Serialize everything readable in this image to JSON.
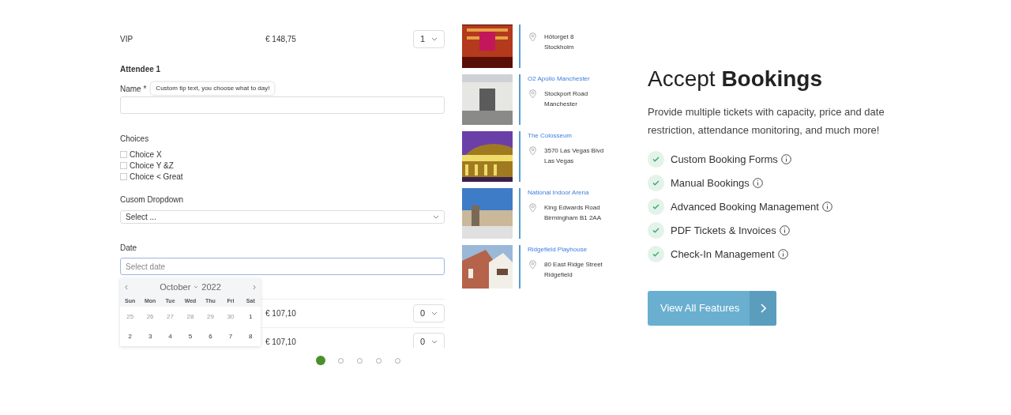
{
  "tickets": [
    {
      "name": "VIP",
      "price": "€ 148,75",
      "quantity": "1"
    }
  ],
  "attendee": {
    "title": "Attendee 1",
    "name_label": "Name *",
    "tooltip": "Custom tip text, you choose what to day!",
    "choices_label": "Choices",
    "choices": [
      {
        "label": "Choice X",
        "checked": false
      },
      {
        "label": "Choice Y &Z",
        "checked": false
      },
      {
        "label": "Choice < Great",
        "checked": false
      }
    ],
    "dropdown_label": "Cusom Dropdown",
    "dropdown_value": "Select ...",
    "date_label": "Date",
    "date_placeholder": "Select date"
  },
  "calendar": {
    "month": "October",
    "year": "2022",
    "prev": "‹",
    "next": "›",
    "weekdays": [
      "Sun",
      "Mon",
      "Tue",
      "Wed",
      "Thu",
      "Fri",
      "Sat"
    ],
    "weeks": [
      [
        {
          "day": "25",
          "muted": true
        },
        {
          "day": "26",
          "muted": true
        },
        {
          "day": "27",
          "muted": true
        },
        {
          "day": "28",
          "muted": true
        },
        {
          "day": "29",
          "muted": true
        },
        {
          "day": "30",
          "muted": true
        },
        {
          "day": "1",
          "muted": false
        }
      ],
      [
        {
          "day": "2",
          "muted": false
        },
        {
          "day": "3",
          "muted": false
        },
        {
          "day": "4",
          "muted": false
        },
        {
          "day": "5",
          "muted": false
        },
        {
          "day": "6",
          "muted": false
        },
        {
          "day": "7",
          "muted": false
        },
        {
          "day": "8",
          "muted": false
        }
      ]
    ]
  },
  "more_tickets": [
    {
      "price": "€ 107,10",
      "quantity": "0"
    },
    {
      "price": "€ 107,10",
      "quantity": "0"
    }
  ],
  "venues": [
    {
      "address": "Hötorget 8",
      "city": "Stockholm"
    },
    {
      "name": "O2 Apollo Manchester",
      "address": "Stockport Road",
      "city": "Manchester"
    },
    {
      "name": "The Colosseum",
      "address": "3570 Las Vegas Blvd",
      "city": "Las Vegas"
    },
    {
      "name": "National Indoor Arena",
      "address": "King Edwards Road",
      "city": "Birmingham B1 2AA"
    },
    {
      "name": "Ridgefield Playhouse",
      "address": "80 East Ridge Street",
      "city": "Ridgefield"
    }
  ],
  "slider_dots": [
    {
      "selected": true
    },
    {
      "selected": false
    },
    {
      "selected": false
    },
    {
      "selected": false
    },
    {
      "selected": false
    }
  ],
  "heading": {
    "light": "Accept",
    "bold": "Bookings"
  },
  "description": "Provide multiple tickets with capacity, price and date restriction, attendance monitoring, and much more!",
  "features": [
    "Custom Booking Forms",
    "Manual Bookings",
    "Advanced Booking Management",
    "PDF Tickets & Invoices",
    "Check-In Management"
  ],
  "cta": {
    "label": "View All Features"
  }
}
